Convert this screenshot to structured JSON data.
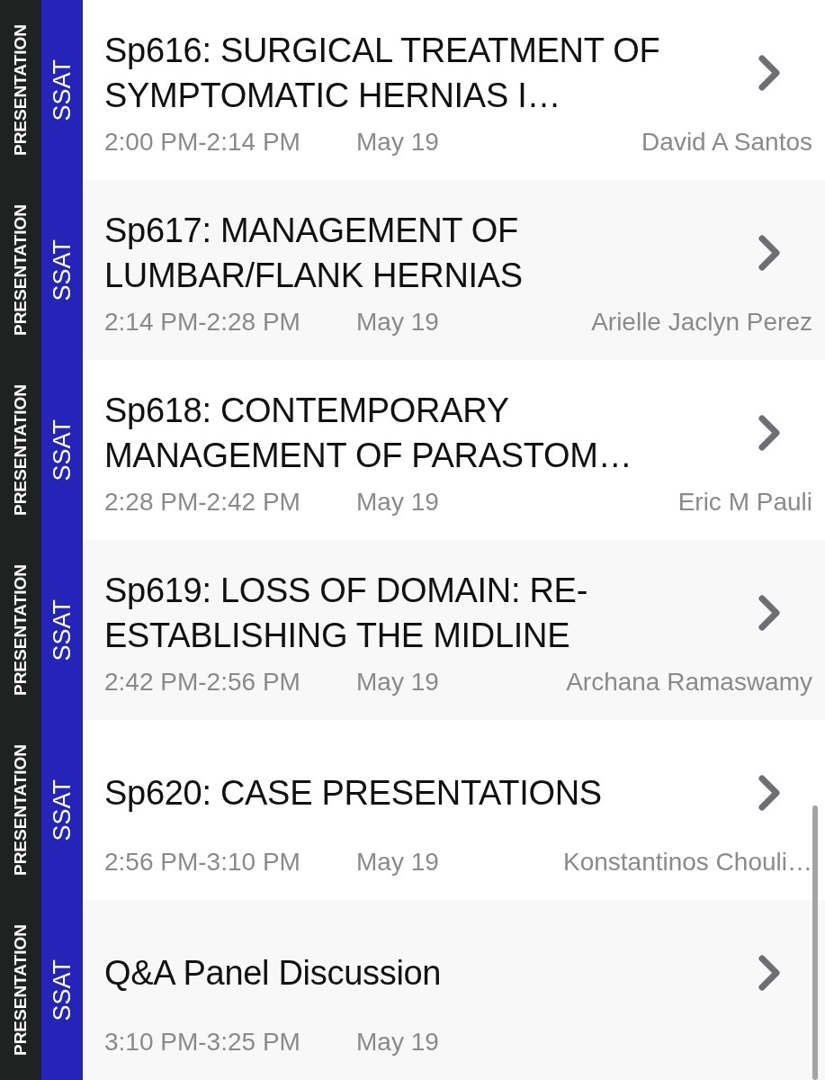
{
  "sessions": [
    {
      "type_label": "PRESENTATION",
      "society": "SSAT",
      "title": "Sp616: SURGICAL TREATMENT OF SYMPTOMATIC HERNIAS I…",
      "time": "2:00 PM-2:14 PM",
      "date": "May 19",
      "speaker": "David A Santos"
    },
    {
      "type_label": "PRESENTATION",
      "society": "SSAT",
      "title": "Sp617: MANAGEMENT OF LUMBAR/FLANK HERNIAS",
      "time": "2:14 PM-2:28 PM",
      "date": "May 19",
      "speaker": "Arielle Jaclyn Perez"
    },
    {
      "type_label": "PRESENTATION",
      "society": "SSAT",
      "title": "Sp618: CONTEMPORARY MANAGEMENT OF PARASTOM…",
      "time": "2:28 PM-2:42 PM",
      "date": "May 19",
      "speaker": "Eric M Pauli"
    },
    {
      "type_label": "PRESENTATION",
      "society": "SSAT",
      "title": "Sp619: LOSS OF DOMAIN: RE-ESTABLISHING THE MIDLINE",
      "time": "2:42 PM-2:56 PM",
      "date": "May 19",
      "speaker": "Archana Ramaswamy"
    },
    {
      "type_label": "PRESENTATION",
      "society": "SSAT",
      "title": "Sp620: CASE PRESENTATIONS",
      "time": "2:56 PM-3:10 PM",
      "date": "May 19",
      "speaker": "Konstantinos Chouli…"
    },
    {
      "type_label": "PRESENTATION",
      "society": "SSAT",
      "title": "Q&A Panel Discussion",
      "time": "3:10 PM-3:25 PM",
      "date": "May 19"
    }
  ]
}
